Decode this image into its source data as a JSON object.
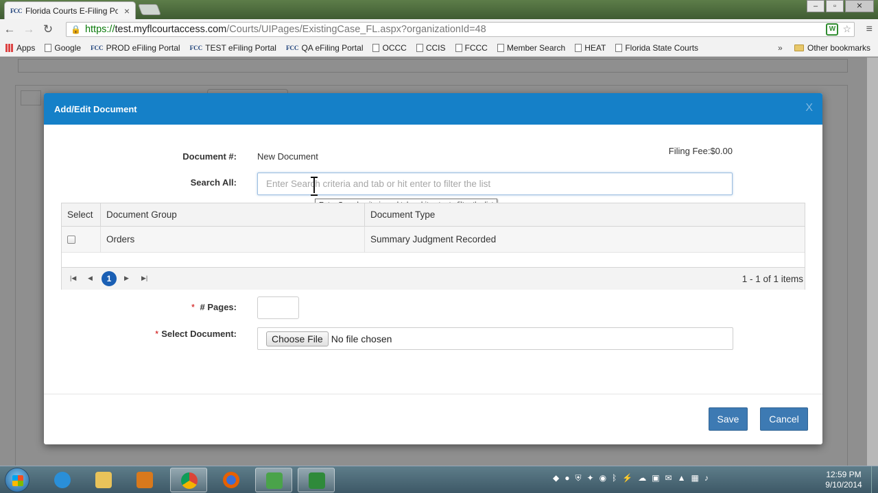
{
  "browser": {
    "tab_title": "Florida Courts E-Filing Po",
    "tab_favicon": "FCC",
    "tab_close": "×",
    "url_scheme": "https://",
    "url_host": "test.myflcourtaccess.com",
    "url_path": "/Courts/UIPages/ExistingCase_FL.aspx?organizationId=48",
    "window_controls": [
      "–",
      "▫",
      "✕"
    ]
  },
  "bookmarks": {
    "items": [
      {
        "label": "Apps",
        "icon": "apps-grid-icon"
      },
      {
        "label": "Google",
        "icon": "page-icon"
      },
      {
        "label": "PROD eFiling Portal",
        "icon": "fcc-icon"
      },
      {
        "label": "TEST eFiling Portal",
        "icon": "fcc-icon"
      },
      {
        "label": "QA eFiling Portal",
        "icon": "fcc-icon"
      },
      {
        "label": "OCCC",
        "icon": "page-icon"
      },
      {
        "label": "CCIS",
        "icon": "page-icon"
      },
      {
        "label": "FCCC",
        "icon": "page-icon"
      },
      {
        "label": "Member Search",
        "icon": "page-icon"
      },
      {
        "label": "HEAT",
        "icon": "page-icon"
      },
      {
        "label": "Florida State Courts",
        "icon": "page-icon"
      }
    ],
    "more": "»",
    "other": "Other bookmarks"
  },
  "modal": {
    "title": "Add/Edit Document",
    "close": "X",
    "document_label": "Document #:",
    "document_value": "New Document",
    "filing_fee": "Filing Fee:$0.00",
    "search_label": "Search All:",
    "search_placeholder": "Enter Search criteria and tab or hit enter to filter the list",
    "tooltip": "Enter Search criteria and tab or hit enter to filter the list",
    "grid": {
      "headers": [
        "Select",
        "Document Group",
        "Document Type"
      ],
      "rows": [
        {
          "group": "Orders",
          "type": "Summary Judgment Recorded"
        }
      ],
      "current_page": "1",
      "pager_info": "1 - 1 of 1 items"
    },
    "pages_label": "# Pages:",
    "required_mark": "*",
    "select_doc_label": "Select Document:",
    "choose_file": "Choose File",
    "no_file": "No file chosen",
    "save": "Save",
    "cancel": "Cancel"
  },
  "taskbar": {
    "time": "12:59 PM",
    "date": "9/10/2014"
  },
  "colors": {
    "modal_header": "#1580c8",
    "primary_button": "#3d7ab3",
    "pager_active": "#1a5fb4"
  }
}
